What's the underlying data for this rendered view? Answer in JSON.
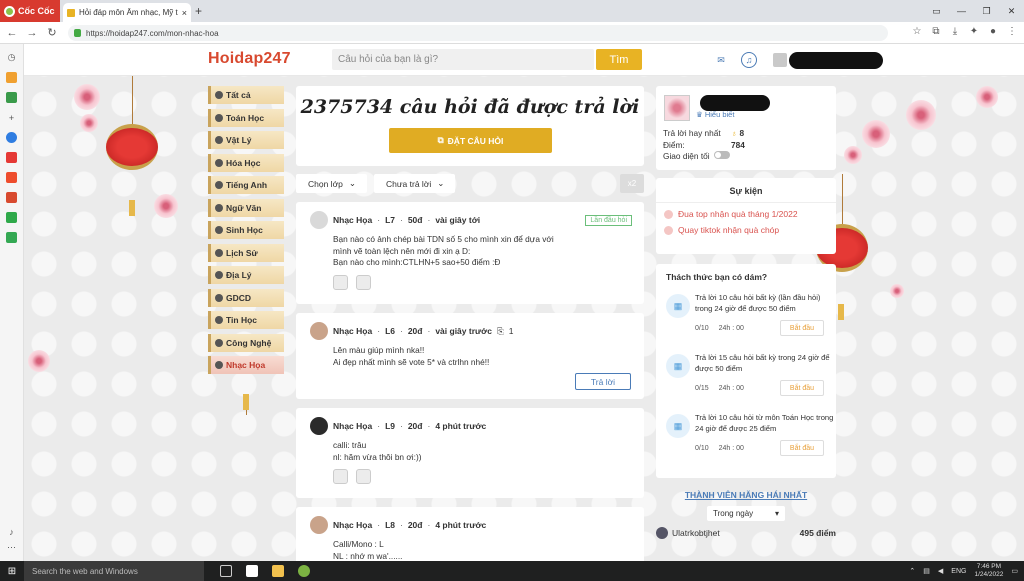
{
  "browser": {
    "brand_label": "Cốc Cốc",
    "tab_title": "Hỏi đáp môn Âm nhạc, Mỹ t",
    "tab_close": "×",
    "new_tab": "+",
    "url": "https://hoidap247.com/mon-nhac-hoa",
    "win_controls": [
      "▭",
      "—",
      "❐",
      "✕"
    ]
  },
  "site": {
    "brand": "Hoidap247",
    "search_placeholder": "Câu hỏi của bạn là gì?",
    "search_button": "Tìm"
  },
  "categories": [
    {
      "label": "Tất cả",
      "active": false
    },
    {
      "label": "Toán Học",
      "active": false
    },
    {
      "label": "Vật Lý",
      "active": false
    },
    {
      "label": "Hóa Học",
      "active": false
    },
    {
      "label": "Tiếng Anh",
      "active": false
    },
    {
      "label": "Ngữ Văn",
      "active": false
    },
    {
      "label": "Sinh Học",
      "active": false
    },
    {
      "label": "Lịch Sử",
      "active": false
    },
    {
      "label": "Địa Lý",
      "active": false
    },
    {
      "label": "GDCD",
      "active": false
    },
    {
      "label": "Tin Học",
      "active": false
    },
    {
      "label": "Công Nghệ",
      "active": false
    },
    {
      "label": "Nhạc Họa",
      "active": true
    }
  ],
  "hero": {
    "title": "2375734 câu hỏi đã được trả lời",
    "ask_button": "ĐẶT CÂU HỎI"
  },
  "filters": {
    "class_select": "Chọn lớp",
    "status_select": "Chưa trả lời",
    "count": "x2"
  },
  "posts": [
    {
      "subject": "Nhạc Họa",
      "grade": "L7",
      "points": "50đ",
      "time": "vài giây tới",
      "badge": "Lần đầu hỏi",
      "lines": [
        "Bạn nào có ảnh chép bài TDN số 5 cho mình xin để dựa với",
        "mình vẽ toàn lệch nên mới đi xin ạ D:",
        "Bạn nào cho mình:CTLHN+5 sao+50 điểm :Đ"
      ],
      "reply": ""
    },
    {
      "subject": "Nhạc Họa",
      "grade": "L6",
      "points": "20đ",
      "time": "vài giây trước",
      "attach": "1",
      "lines": [
        "Lên màu giúp mình nka!!",
        "Ai đẹp nhất mình sẽ vote 5* và ctrlhn nhé!!"
      ],
      "reply": "Trả lời"
    },
    {
      "subject": "Nhạc Họa",
      "grade": "L9",
      "points": "20đ",
      "time": "4 phút trước",
      "lines": [
        "calli: trâu",
        "nl: hăm vừa thôi bn ơi:))"
      ],
      "reply": ""
    },
    {
      "subject": "Nhạc Họa",
      "grade": "L8",
      "points": "20đ",
      "time": "4 phút trước",
      "lines": [
        "Calli/Mono : L",
        "NL : nhớ m wa'......"
      ],
      "reply": ""
    }
  ],
  "profile": {
    "rank": "Hiểu biết",
    "best_answers_label": "Trả lời hay nhất",
    "best_answers": "8",
    "points_label": "Điểm:",
    "points": "784",
    "theme_label": "Giao diện tối"
  },
  "events": {
    "title": "Sự kiện",
    "items": [
      "Đua top nhận quà tháng 1/2022",
      "Quay tiktok nhận quà chóp"
    ]
  },
  "challenge": {
    "title": "Thách thức bạn có dám?",
    "items": [
      {
        "text": "Trả lời 10 câu hỏi bất kỳ (lần đầu hỏi) trong 24 giờ để được 50 điểm",
        "progress": "0/10",
        "time": "24h : 00",
        "button": "Bắt đầu"
      },
      {
        "text": "Trả lời 15 câu hỏi bất kỳ trong 24 giờ để được 50 điểm",
        "progress": "0/15",
        "time": "24h : 00",
        "button": "Bắt đầu"
      },
      {
        "text": "Trả lời 10 câu hỏi từ môn Toán Học trong 24 giờ để được 25 điểm",
        "progress": "0/10",
        "time": "24h : 00",
        "button": "Bắt đầu"
      }
    ]
  },
  "members": {
    "title": "THÀNH VIÊN HĂNG HÁI NHẤT",
    "period": "Trong ngày",
    "top": [
      {
        "name": "Ulatrkobtjhet",
        "points": "495 điểm"
      }
    ]
  },
  "taskbar": {
    "search_placeholder": "Search the web and Windows",
    "lang": "ENG",
    "time": "7:46 PM",
    "date": "1/24/2022"
  }
}
